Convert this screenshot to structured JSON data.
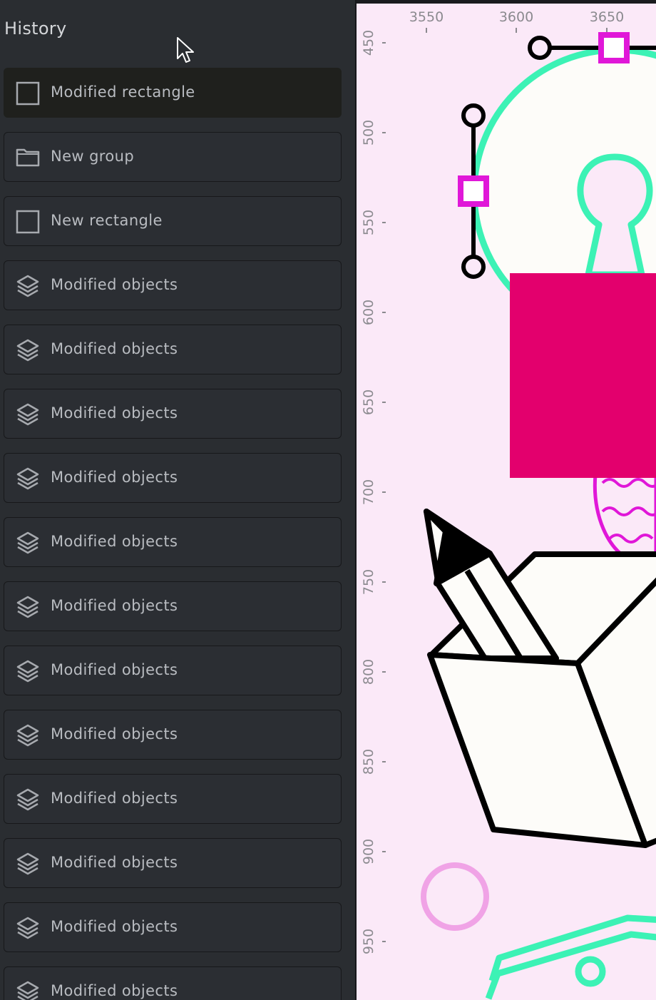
{
  "panel": {
    "title": "History"
  },
  "history": [
    {
      "label": "Modified rectangle",
      "icon": "rectangle-icon",
      "active": true
    },
    {
      "label": "New group",
      "icon": "folder-icon"
    },
    {
      "label": "New rectangle",
      "icon": "rectangle-icon"
    },
    {
      "label": "Modified objects",
      "icon": "layers-icon"
    },
    {
      "label": "Modified objects",
      "icon": "layers-icon"
    },
    {
      "label": "Modified objects",
      "icon": "layers-icon"
    },
    {
      "label": "Modified objects",
      "icon": "layers-icon"
    },
    {
      "label": "Modified objects",
      "icon": "layers-icon"
    },
    {
      "label": "Modified objects",
      "icon": "layers-icon"
    },
    {
      "label": "Modified objects",
      "icon": "layers-icon"
    },
    {
      "label": "Modified objects",
      "icon": "layers-icon"
    },
    {
      "label": "Modified objects",
      "icon": "layers-icon"
    },
    {
      "label": "Modified objects",
      "icon": "layers-icon"
    },
    {
      "label": "Modified objects",
      "icon": "layers-icon"
    },
    {
      "label": "Modified objects",
      "icon": "layers-icon"
    }
  ],
  "ruler": {
    "horizontal": [
      "3550",
      "3600",
      "3650"
    ],
    "vertical": [
      "450",
      "500",
      "550",
      "600",
      "650",
      "700",
      "750",
      "800",
      "850",
      "900",
      "950"
    ]
  },
  "colors": {
    "canvas_bg": "#fbe9f8",
    "selection": "#e017d8",
    "teal": "#3cf2b5",
    "pink_rect": "#e3006d",
    "panel_bg": "#2a2d31"
  }
}
